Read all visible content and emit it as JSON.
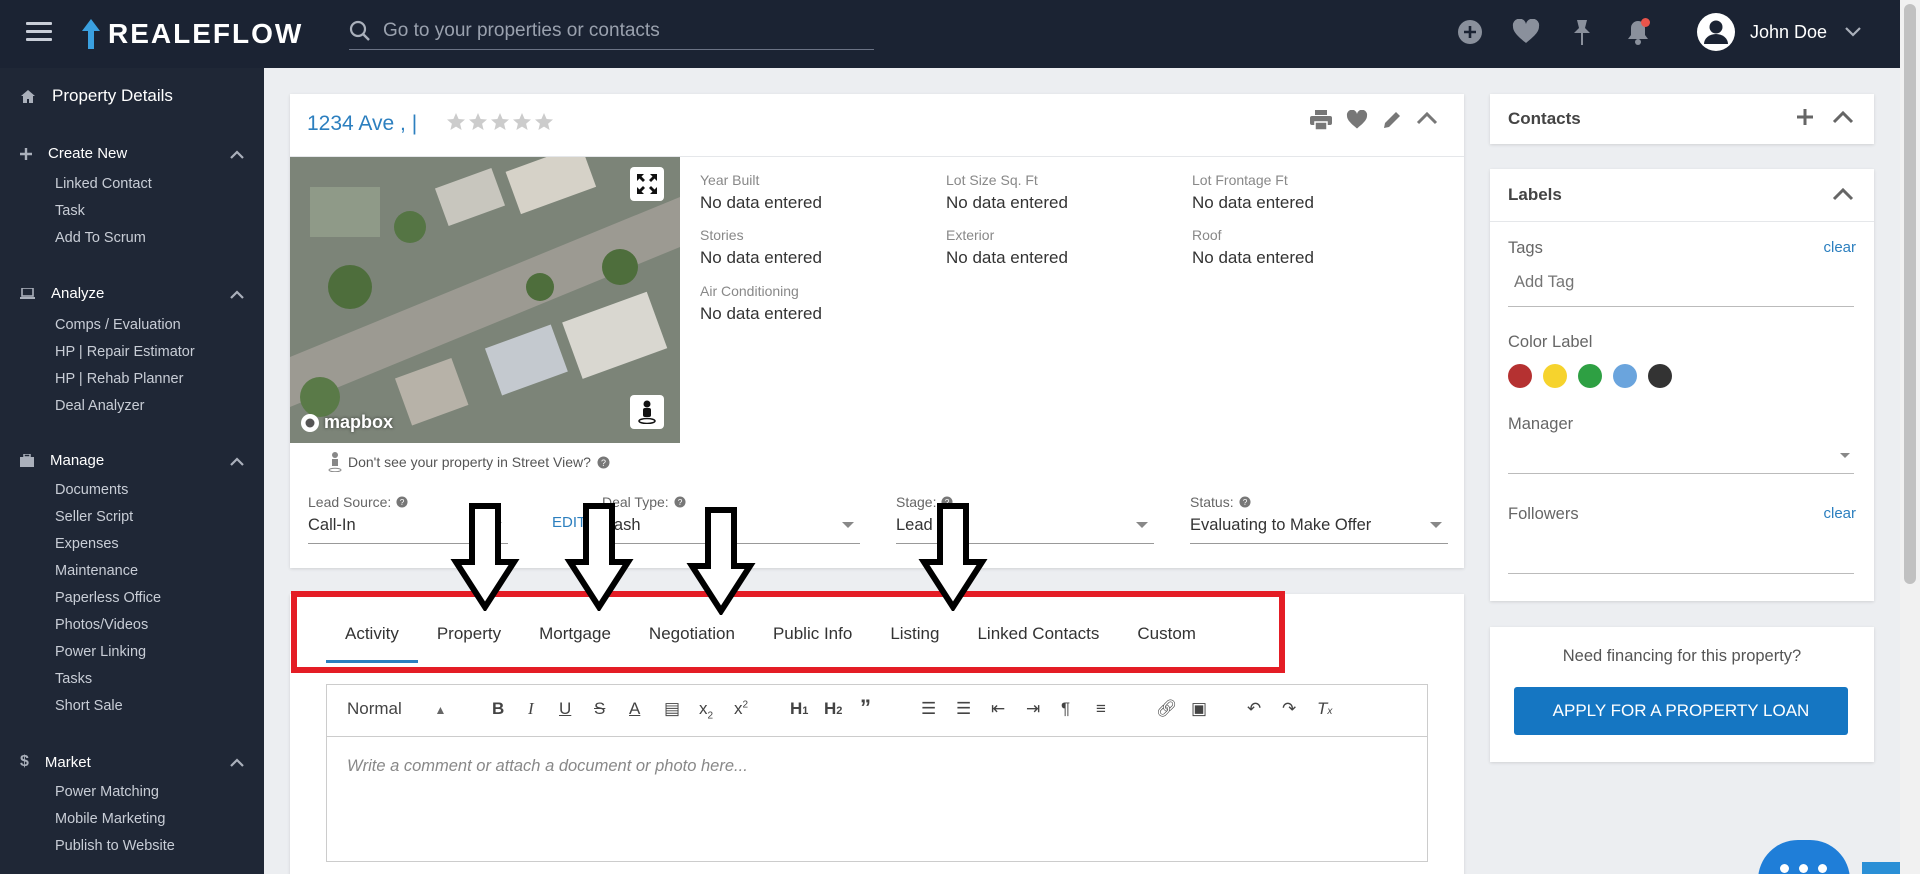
{
  "app": {
    "logo": "REALEFLOW"
  },
  "search": {
    "placeholder": "Go to your properties or contacts"
  },
  "user": {
    "name": "John Doe"
  },
  "sidebar": {
    "property_details": "Property Details",
    "create_new": {
      "label": "Create New",
      "items": [
        "Linked Contact",
        "Task",
        "Add To Scrum"
      ]
    },
    "analyze": {
      "label": "Analyze",
      "items": [
        "Comps / Evaluation",
        "HP | Repair Estimator",
        "HP | Rehab Planner",
        "Deal Analyzer"
      ]
    },
    "manage": {
      "label": "Manage",
      "items": [
        "Documents",
        "Seller Script",
        "Expenses",
        "Maintenance",
        "Paperless Office",
        "Photos/Videos",
        "Power Linking",
        "Tasks",
        "Short Sale"
      ]
    },
    "market": {
      "label": "Market",
      "items": [
        "Power Matching",
        "Mobile Marketing",
        "Publish to Website"
      ]
    }
  },
  "property": {
    "title": "1234 Ave ,  |",
    "map_logo": "mapbox",
    "street_view_note": "Don't see your property in Street View?",
    "facts": [
      {
        "label": "Year Built",
        "value": "No data entered"
      },
      {
        "label": "Lot Size Sq. Ft",
        "value": "No data entered"
      },
      {
        "label": "Lot Frontage Ft",
        "value": "No data entered"
      },
      {
        "label": "Stories",
        "value": "No data entered"
      },
      {
        "label": "Exterior",
        "value": "No data entered"
      },
      {
        "label": "Roof",
        "value": "No data entered"
      },
      {
        "label": "Air Conditioning",
        "value": "No data entered"
      }
    ],
    "lead_source": {
      "label": "Lead Source:",
      "value": "Call-In",
      "edit": "EDIT"
    },
    "deal_type": {
      "label": "Deal Type:",
      "value": "Cash"
    },
    "stage": {
      "label": "Stage:",
      "value": "Lead"
    },
    "status": {
      "label": "Status:",
      "value": "Evaluating to Make Offer"
    }
  },
  "tabs": [
    "Activity",
    "Property",
    "Mortgage",
    "Negotiation",
    "Public Info",
    "Listing",
    "Linked Contacts",
    "Custom"
  ],
  "editor": {
    "format": "Normal",
    "placeholder": "Write a comment or attach a document or photo here..."
  },
  "contacts": {
    "title": "Contacts"
  },
  "labels": {
    "title": "Labels",
    "tags": "Tags",
    "clear": "clear",
    "add_tag_placeholder": "Add Tag",
    "color_label": "Color Label",
    "colors": [
      "#b53131",
      "#f6d32d",
      "#2ea043",
      "#6aa4dd",
      "#333333"
    ],
    "manager": "Manager",
    "followers": "Followers"
  },
  "financing": {
    "question": "Need financing for this property?",
    "button": "APPLY FOR A PROPERTY LOAN"
  }
}
